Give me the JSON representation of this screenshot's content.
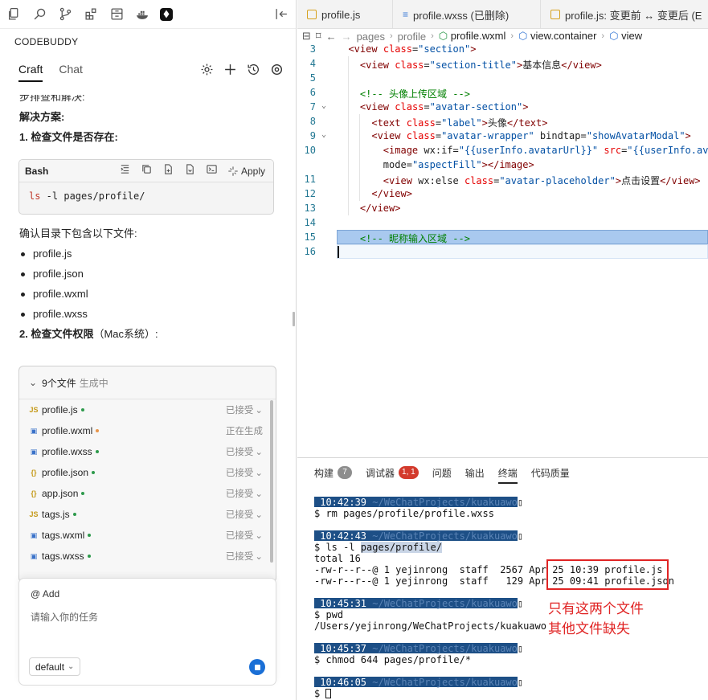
{
  "left": {
    "brand": "CODEBUDDY",
    "tabs": [
      "Craft",
      "Chat"
    ],
    "cut_text": "步排查和解决:",
    "solution_title": "解决方案:",
    "step1": "1. 检查文件是否存在:",
    "codeblock": {
      "lang": "Bash",
      "apply": "Apply",
      "cmd": "ls",
      "args": " -l pages/profile/"
    },
    "confirm_text": "确认目录下包含以下文件:",
    "file_bullets": [
      "profile.js",
      "profile.json",
      "profile.wxml",
      "profile.wxss"
    ],
    "step2_bold": "2. 检查文件权限",
    "step2_rest": "（Mac系统）:",
    "files_panel": {
      "title": "9个文件",
      "status": "生成中",
      "rows": [
        {
          "icon": "JS",
          "name": "profile.js",
          "status": "已接受",
          "dot": "green"
        },
        {
          "icon": "WX",
          "name": "profile.wxml",
          "status": "正在生成",
          "dot": "orange"
        },
        {
          "icon": "WX",
          "name": "profile.wxss",
          "status": "已接受",
          "dot": "green"
        },
        {
          "icon": "{}",
          "name": "profile.json",
          "status": "已接受",
          "dot": "green"
        },
        {
          "icon": "{}",
          "name": "app.json",
          "status": "已接受",
          "dot": "green"
        },
        {
          "icon": "JS",
          "name": "tags.js",
          "status": "已接受",
          "dot": "green"
        },
        {
          "icon": "WX",
          "name": "tags.wxml",
          "status": "已接受",
          "dot": "green"
        },
        {
          "icon": "WX",
          "name": "tags.wxss",
          "status": "已接受",
          "dot": "green"
        }
      ]
    },
    "input": {
      "at_label": "@ Add",
      "placeholder": "请输入你的任务",
      "model": "default"
    }
  },
  "editor": {
    "tabs": [
      "profile.js",
      "profile.wxss (已删除)",
      "profile.js: 变更前 ↔ 变更后 (E"
    ],
    "breadcrumb": [
      "pages",
      "profile",
      "profile.wxml",
      "view.container",
      "view"
    ],
    "line_numbers": [
      "3",
      "4",
      "5",
      "6",
      "7",
      "8",
      "9",
      "10",
      "",
      "11",
      "12",
      "13",
      "14",
      "15",
      "16"
    ]
  },
  "terminal": {
    "tabs": [
      {
        "label": "构建",
        "badge": "7"
      },
      {
        "label": "调试器",
        "badge": "1, 1"
      },
      {
        "label": "问题",
        "badge": ""
      },
      {
        "label": "输出",
        "badge": ""
      },
      {
        "label": "终端",
        "badge": ""
      },
      {
        "label": "代码质量",
        "badge": ""
      }
    ],
    "lines": {
      "t1": " 10:42:39 ",
      "p1": "~/WeChatProjects/kuakuawo",
      "c1": "$ rm pages/profile/profile.wxss",
      "t2": " 10:42:43 ",
      "p2": "~/WeChatProjects/kuakuawo",
      "c2a": "$ ls -l ",
      "c2b": "pages/profile/",
      "o1": "total 16",
      "o2": "-rw-r--r--@ 1 yejinrong  staff  2567 Apr 25 10:39 profile.js",
      "o3": "-rw-r--r--@ 1 yejinrong  staff   129 Apr 25 09:41 profile.json",
      "t3": " 10:45:31 ",
      "p3": "~/WeChatProjects/kuakuawo",
      "c3": "$ pwd",
      "o4": "/Users/yejinrong/WeChatProjects/kuakuawo",
      "t4": " 10:45:37 ",
      "p4": "~/WeChatProjects/kuakuawo",
      "c4": "$ chmod 644 pages/profile/*",
      "t5": " 10:46:05 ",
      "p5": "~/WeChatProjects/kuakuawo",
      "c5": "$ "
    },
    "annotation": [
      "只有这两个文件",
      "其他文件缺失"
    ]
  },
  "colors": {
    "accent": "#1a6fd6",
    "annotation": "#e02424",
    "prompt_bg": "#1d4f86",
    "selection": "#a9c9ef"
  }
}
